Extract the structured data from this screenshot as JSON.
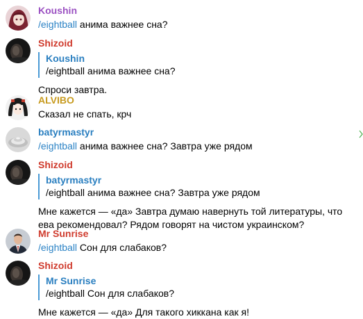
{
  "colors": {
    "koushin": "#9b51c2",
    "shizoid": "#cf3a2c",
    "alvibo": "#c79a1e",
    "batyrmastyr": "#2a7fc0",
    "mr_sunrise": "#cf3a2c",
    "command_link": "#2a82c5",
    "reply_bar": "#4a9ad6"
  },
  "messages": [
    {
      "sender": "Koushin",
      "cmd": "/eightball",
      "text": " анима важнее сна?"
    },
    {
      "sender": "Shizoid",
      "reply_name": "Koushin",
      "reply_text": "/eightball анима важнее сна?",
      "text": "Спроси завтра."
    },
    {
      "sender": "ALVIBO",
      "text": "Сказал не спать, крч"
    },
    {
      "sender": "batyrmastyr",
      "cmd": "/eightball",
      "text": " анима важнее сна? Завтра уже рядом"
    },
    {
      "sender": "Shizoid",
      "reply_name": "batyrmastyr",
      "reply_text": "/eightball анима важнее сна? Завтра уже рядом",
      "text": "Мне кажется — «да» Завтра думаю навернуть той литературы, что ева рекомендовал? Рядом говорят на чистом украинском?"
    },
    {
      "sender": "Mr Sunrise",
      "cmd": "/eightball",
      "text": " Сон для слабаков?"
    },
    {
      "sender": "Shizoid",
      "reply_name": "Mr Sunrise",
      "reply_text": "/eightball Сон для слабаков?",
      "text": "Мне кажется — «да» Для такого хиккана как я!"
    }
  ]
}
